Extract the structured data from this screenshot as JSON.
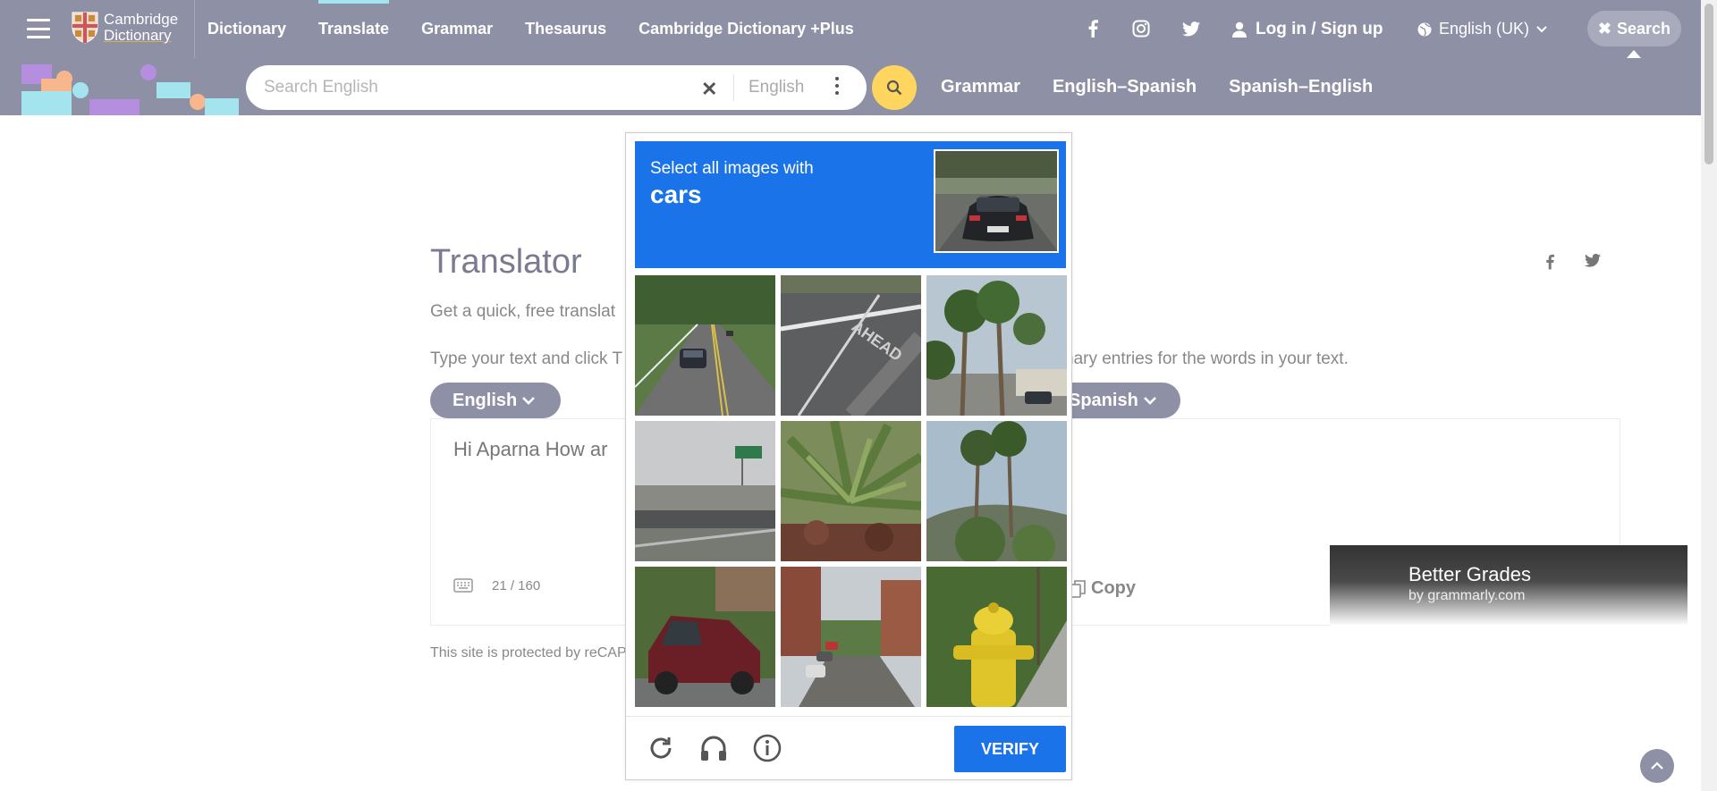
{
  "header": {
    "logo_line1": "Cambridge",
    "logo_line2": "Dictionary",
    "nav": [
      "Dictionary",
      "Translate",
      "Grammar",
      "Thesaurus",
      "Cambridge Dictionary +Plus"
    ],
    "active_nav": "Translate",
    "social_icons": [
      "facebook-icon",
      "instagram-icon",
      "twitter-icon"
    ],
    "login_label": "Log in / Sign up",
    "language_label": "English (UK)",
    "search_label": "Search"
  },
  "searchbar": {
    "placeholder": "Search English",
    "dictionary": "English",
    "links": [
      "Grammar",
      "English–Spanish",
      "Spanish–English"
    ]
  },
  "translator": {
    "title": "Translator",
    "intro_start": "Get a quick, free translat",
    "instruction_start": "Type your text and click T",
    "instruction_end": "nary entries for the words in your text.",
    "source_lang": "English",
    "target_lang": "Spanish",
    "input_text": "Hi Aparna How ar",
    "char_count": "21 / 160",
    "copy_label": "Copy",
    "protected_text": "This site is protected by reCAP"
  },
  "ad": {
    "title": "Better Grades",
    "subtitle": "by grammarly.com"
  },
  "captcha": {
    "prompt": "Select all images with",
    "target": "cars",
    "tiles": [
      "road-with-car",
      "road-pavement",
      "palm-trees-parking",
      "highway-overpass",
      "palm-shrub",
      "palm-trees-hill",
      "red-pickup-truck",
      "residential-street-cars",
      "yellow-fire-hydrant"
    ],
    "reload_icon": "reload-icon",
    "audio_icon": "headphones-icon",
    "info_icon": "info-icon",
    "verify_label": "VERIFY"
  },
  "colors": {
    "nav_bg": "#8e90a6",
    "captcha_blue": "#1a73e8",
    "search_yellow": "#fed55f"
  }
}
